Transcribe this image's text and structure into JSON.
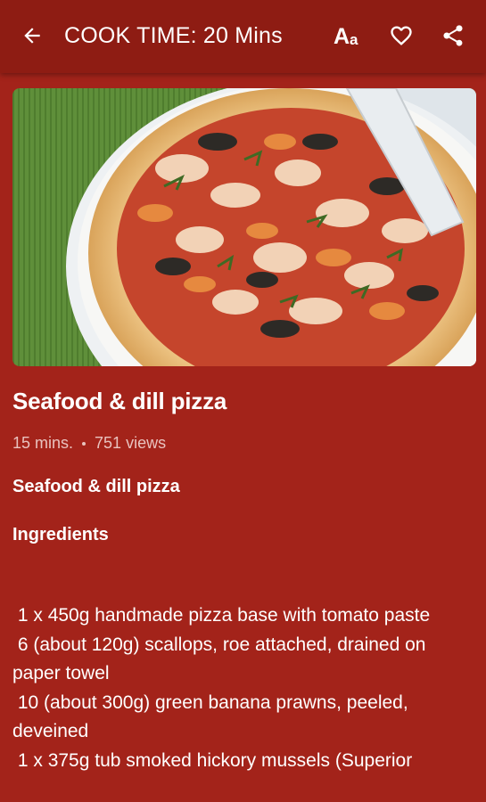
{
  "header": {
    "title": "COOK TIME: 20 Mins",
    "back_icon": "arrow-left-icon",
    "font_icon": "font-size-icon",
    "font_icon_text": "Aa",
    "favorite_icon": "heart-outline-icon",
    "share_icon": "share-icon"
  },
  "recipe": {
    "name": "Seafood & dill pizza",
    "time": "15 mins.",
    "views": "751 views",
    "subtitle": "Seafood & dill pizza",
    "ingredients_heading": "Ingredients",
    "ingredients": [
      " 1 x 450g handmade pizza base with tomato paste",
      " 6 (about 120g) scallops, roe attached, drained on paper towel",
      " 10 (about 300g) green banana prawns, peeled, deveined",
      " 1 x 375g tub smoked hickory mussels (Superior"
    ]
  },
  "colors": {
    "background": "#a3231a",
    "appbar": "#8e1c13",
    "muted_text": "#e9c3bf"
  }
}
